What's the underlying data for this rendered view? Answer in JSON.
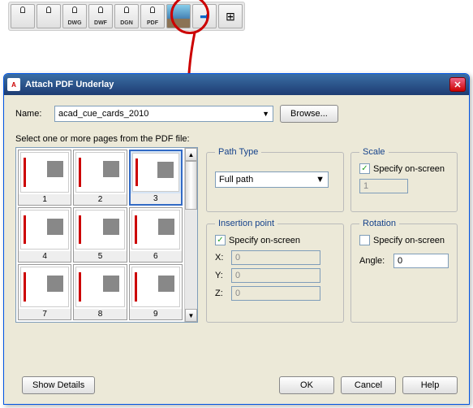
{
  "toolbar": {
    "items": [
      {
        "label": "",
        "name": "attach-icon"
      },
      {
        "label": "",
        "name": "clip-icon"
      },
      {
        "label": "DWG",
        "name": "dwg-icon"
      },
      {
        "label": "DWF",
        "name": "dwf-icon"
      },
      {
        "label": "DGN",
        "name": "dgn-icon"
      },
      {
        "label": "PDF",
        "name": "pdf-icon"
      },
      {
        "label": "",
        "name": "image-icon"
      },
      {
        "label": "",
        "name": "arrow-icon"
      },
      {
        "label": "",
        "name": "grid-icon"
      }
    ]
  },
  "dialog": {
    "title": "Attach PDF Underlay",
    "name_label": "Name:",
    "name_value": "acad_cue_cards_2010",
    "browse": "Browse...",
    "select_label": "Select one or more pages from the PDF file:",
    "thumbnails": [
      "1",
      "2",
      "3",
      "4",
      "5",
      "6",
      "7",
      "8",
      "9"
    ],
    "selected_thumb": 3,
    "path": {
      "legend": "Path Type",
      "value": "Full path"
    },
    "scale": {
      "legend": "Scale",
      "specify": "Specify on-screen",
      "value": "1",
      "checked": true
    },
    "insertion": {
      "legend": "Insertion point",
      "specify": "Specify on-screen",
      "checked": true,
      "x_label": "X:",
      "y_label": "Y:",
      "z_label": "Z:",
      "x": "0",
      "y": "0",
      "z": "0"
    },
    "rotation": {
      "legend": "Rotation",
      "specify": "Specify on-screen",
      "checked": false,
      "angle_label": "Angle:",
      "angle": "0"
    },
    "buttons": {
      "show_details": "Show Details",
      "ok": "OK",
      "cancel": "Cancel",
      "help": "Help"
    }
  }
}
